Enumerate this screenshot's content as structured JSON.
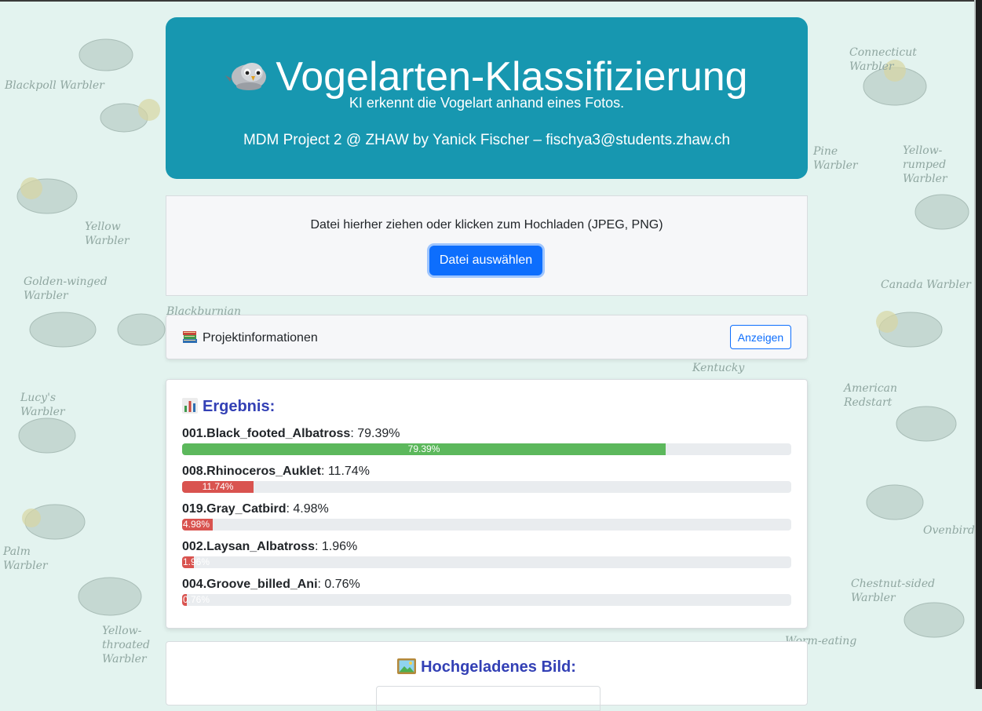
{
  "hero": {
    "title": "Vogelarten-Klassifizierung",
    "subtitle": "KI erkennt die Vogelart anhand eines Fotos.",
    "author": "MDM Project 2 @ ZHAW by Yanick Fischer – fischya3@students.zhaw.ch",
    "title_icon": "bird-icon"
  },
  "upload": {
    "prompt": "Datei hierher ziehen oder klicken zum Hochladen (JPEG, PNG)",
    "button_label": "Datei auswählen"
  },
  "info": {
    "label": "Projektinformationen",
    "icon": "books-icon",
    "button_label": "Anzeigen"
  },
  "results": {
    "title": "Ergebnis:",
    "icon": "bar-chart-icon",
    "predictions": [
      {
        "name": "001.Black_footed_Albatross",
        "percent_text": "79.39%",
        "percent": 79.39,
        "color": "#5cb85c"
      },
      {
        "name": "008.Rhinoceros_Auklet",
        "percent_text": "11.74%",
        "percent": 11.74,
        "color": "#d9534f"
      },
      {
        "name": "019.Gray_Catbird",
        "percent_text": "4.98%",
        "percent": 4.98,
        "color": "#d9534f"
      },
      {
        "name": "002.Laysan_Albatross",
        "percent_text": "1.96%",
        "percent": 1.96,
        "color": "#d9534f"
      },
      {
        "name": "004.Groove_billed_Ani",
        "percent_text": "0.76%",
        "percent": 0.76,
        "color": "#d9534f"
      }
    ]
  },
  "uploaded": {
    "title": "Hochgeladenes Bild:",
    "icon": "framed-picture-icon"
  },
  "background_labels": [
    "Blackpoll Warbler",
    "Yellow Warbler",
    "Golden-winged Warbler",
    "Lucy's Warbler",
    "Palm Warbler",
    "Yellow-throated Warbler",
    "Connecticut Warbler",
    "Yellow-rumped Warbler",
    "Canada Warbler",
    "American Redstart",
    "Ovenbird",
    "Chestnut-sided Warbler",
    "Pine Warbler",
    "Blackburnian",
    "Kentucky",
    "Worm-eating"
  ],
  "colors": {
    "hero_bg": "#1797b0",
    "accent_title": "#3340b5",
    "primary": "#0d6efd",
    "success": "#5cb85c",
    "danger": "#d9534f"
  }
}
